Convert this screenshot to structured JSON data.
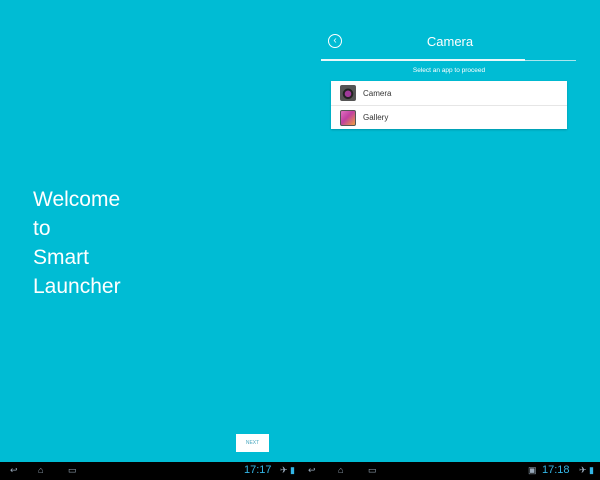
{
  "left_screen": {
    "welcome_lines": [
      "Welcome",
      "to",
      "Smart",
      "Launcher"
    ],
    "next_label": "NEXT"
  },
  "right_screen": {
    "title": "Camera",
    "subtitle": "Select an app to proceed",
    "apps": [
      {
        "label": "Camera",
        "icon": "camera-icon"
      },
      {
        "label": "Gallery",
        "icon": "gallery-icon"
      }
    ]
  },
  "status_bar": {
    "left_time": "17:17",
    "right_time": "17:18"
  },
  "colors": {
    "background": "#00bcd4",
    "clock": "#33b5e5"
  }
}
